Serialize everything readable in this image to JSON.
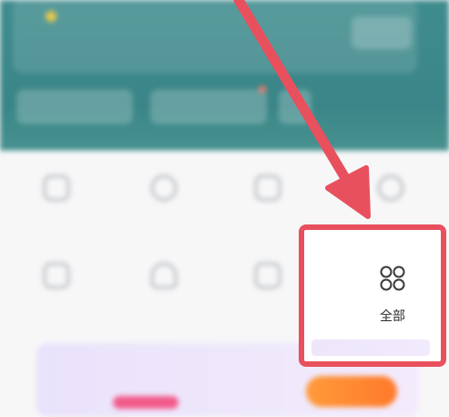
{
  "header": {
    "banner_title": "",
    "banner_subtitle": "",
    "banner_button": "",
    "buttons": [
      "",
      "",
      ""
    ]
  },
  "grid": {
    "row1": [
      {
        "icon": "home-icon",
        "label": ""
      },
      {
        "icon": "clock-icon",
        "label": ""
      },
      {
        "icon": "book-icon",
        "label": ""
      },
      {
        "icon": "globe-icon",
        "label": ""
      }
    ],
    "row2": [
      {
        "icon": "document-icon",
        "label": ""
      },
      {
        "icon": "person-icon",
        "label": ""
      },
      {
        "icon": "folder-icon",
        "label": ""
      }
    ],
    "all": {
      "icon": "grid-four-circles-icon",
      "label": "全部"
    }
  },
  "promo": {
    "title": "",
    "subtitle": "",
    "button": ""
  },
  "annotation": {
    "arrow_color": "#e8505e",
    "box_color": "#e8505e"
  },
  "colors": {
    "header_teal": "#3f8c8e",
    "accent_red": "#e8505e"
  }
}
